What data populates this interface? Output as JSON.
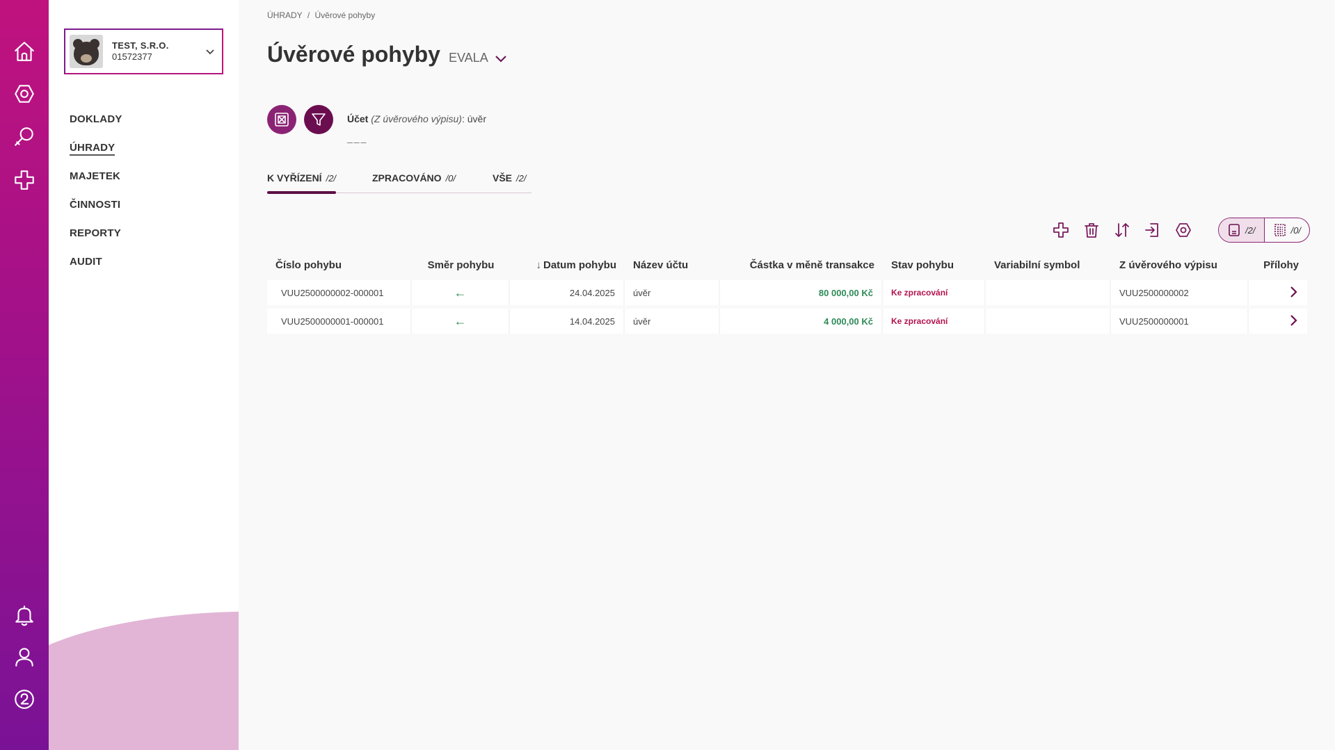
{
  "company": {
    "name": "TEST, S.R.O.",
    "id": "01572377"
  },
  "nav": {
    "items": [
      {
        "label": "DOKLADY"
      },
      {
        "label": "ÚHRADY"
      },
      {
        "label": "MAJETEK"
      },
      {
        "label": "ČINNOSTI"
      },
      {
        "label": "REPORTY"
      },
      {
        "label": "AUDIT"
      }
    ]
  },
  "breadcrumb": {
    "root": "ÚHRADY",
    "separator": "/",
    "current": "Úvěrové pohyby"
  },
  "page": {
    "title": "Úvěrové pohyby",
    "scope": "EVALA"
  },
  "filter": {
    "label": "Účet",
    "detail": "(Z úvěrového výpisu)",
    "value": ": úvěr",
    "dashes": "___"
  },
  "tabs": [
    {
      "label": "K VYŘÍZENÍ",
      "count": "/2/"
    },
    {
      "label": "ZPRACOVÁNO",
      "count": "/0/"
    },
    {
      "label": "VŠE",
      "count": "/2/"
    }
  ],
  "view_toggle": {
    "left_count": "/2/",
    "right_count": "/0/"
  },
  "table": {
    "columns": [
      "Číslo pohybu",
      "Směr pohybu",
      "Datum pohybu",
      "Název účtu",
      "Částka v měně transakce",
      "Stav pohybu",
      "Variabilní symbol",
      "Z úvěrového výpisu",
      "Přílohy"
    ],
    "sort_indicator": "↓",
    "rows": [
      {
        "cislo": "VUU2500000002-000001",
        "smer": "←",
        "datum": "24.04.2025",
        "ucet": "úvěr",
        "castka": "80 000,00 Kč",
        "stav": "Ke zpracování",
        "vs": "",
        "vypis": "VUU2500000002"
      },
      {
        "cislo": "VUU2500000001-000001",
        "smer": "←",
        "datum": "14.04.2025",
        "ucet": "úvěr",
        "castka": "4 000,00 Kč",
        "stav": "Ke zpracování",
        "vs": "",
        "vypis": "VUU2500000001"
      }
    ]
  },
  "colors": {
    "accent": "#6b0e50",
    "rail_top": "#c0127e",
    "rail_bottom": "#7a1296",
    "amount": "#2e8a57",
    "status": "#b4124d"
  },
  "icons": {
    "rail_top": [
      "home-icon",
      "settings-icon",
      "search-icon",
      "add-icon"
    ],
    "rail_bottom": [
      "bell-icon",
      "user-icon",
      "help-icon"
    ]
  }
}
